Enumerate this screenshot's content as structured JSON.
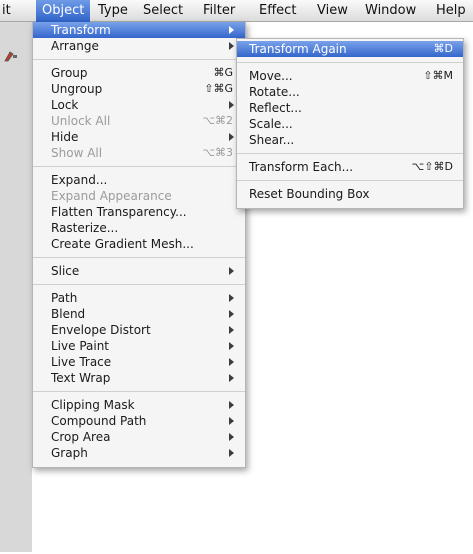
{
  "menubar": {
    "items": [
      "it",
      "Object",
      "Type",
      "Select",
      "Filter",
      "Effect",
      "View",
      "Window",
      "Help"
    ],
    "active": "Object"
  },
  "object_menu": {
    "transform": {
      "label": "Transform"
    },
    "arrange": {
      "label": "Arrange"
    },
    "group": {
      "label": "Group",
      "shortcut": "⌘G"
    },
    "ungroup": {
      "label": "Ungroup",
      "shortcut": "⇧⌘G"
    },
    "lock": {
      "label": "Lock"
    },
    "unlock_all": {
      "label": "Unlock All",
      "shortcut": "⌥⌘2"
    },
    "hide": {
      "label": "Hide"
    },
    "show_all": {
      "label": "Show All",
      "shortcut": "⌥⌘3"
    },
    "expand": {
      "label": "Expand..."
    },
    "expand_appearance": {
      "label": "Expand Appearance"
    },
    "flatten_transparency": {
      "label": "Flatten Transparency..."
    },
    "rasterize": {
      "label": "Rasterize..."
    },
    "create_gradient_mesh": {
      "label": "Create Gradient Mesh..."
    },
    "slice": {
      "label": "Slice"
    },
    "path": {
      "label": "Path"
    },
    "blend": {
      "label": "Blend"
    },
    "envelope_distort": {
      "label": "Envelope Distort"
    },
    "live_paint": {
      "label": "Live Paint"
    },
    "live_trace": {
      "label": "Live Trace"
    },
    "text_wrap": {
      "label": "Text Wrap"
    },
    "clipping_mask": {
      "label": "Clipping Mask"
    },
    "compound_path": {
      "label": "Compound Path"
    },
    "crop_area": {
      "label": "Crop Area"
    },
    "graph": {
      "label": "Graph"
    }
  },
  "transform_submenu": {
    "transform_again": {
      "label": "Transform Again",
      "shortcut": "⌘D"
    },
    "move": {
      "label": "Move...",
      "shortcut": "⇧⌘M"
    },
    "rotate": {
      "label": "Rotate..."
    },
    "reflect": {
      "label": "Reflect..."
    },
    "scale": {
      "label": "Scale..."
    },
    "shear": {
      "label": "Shear..."
    },
    "transform_each": {
      "label": "Transform Each...",
      "shortcut": "⌥⇧⌘D"
    },
    "reset_bounding_box": {
      "label": "Reset Bounding Box"
    }
  },
  "colors": {
    "highlight": "#3466cc",
    "menu_bg": "#f5f5f5",
    "disabled_text": "#9b9b9b"
  }
}
